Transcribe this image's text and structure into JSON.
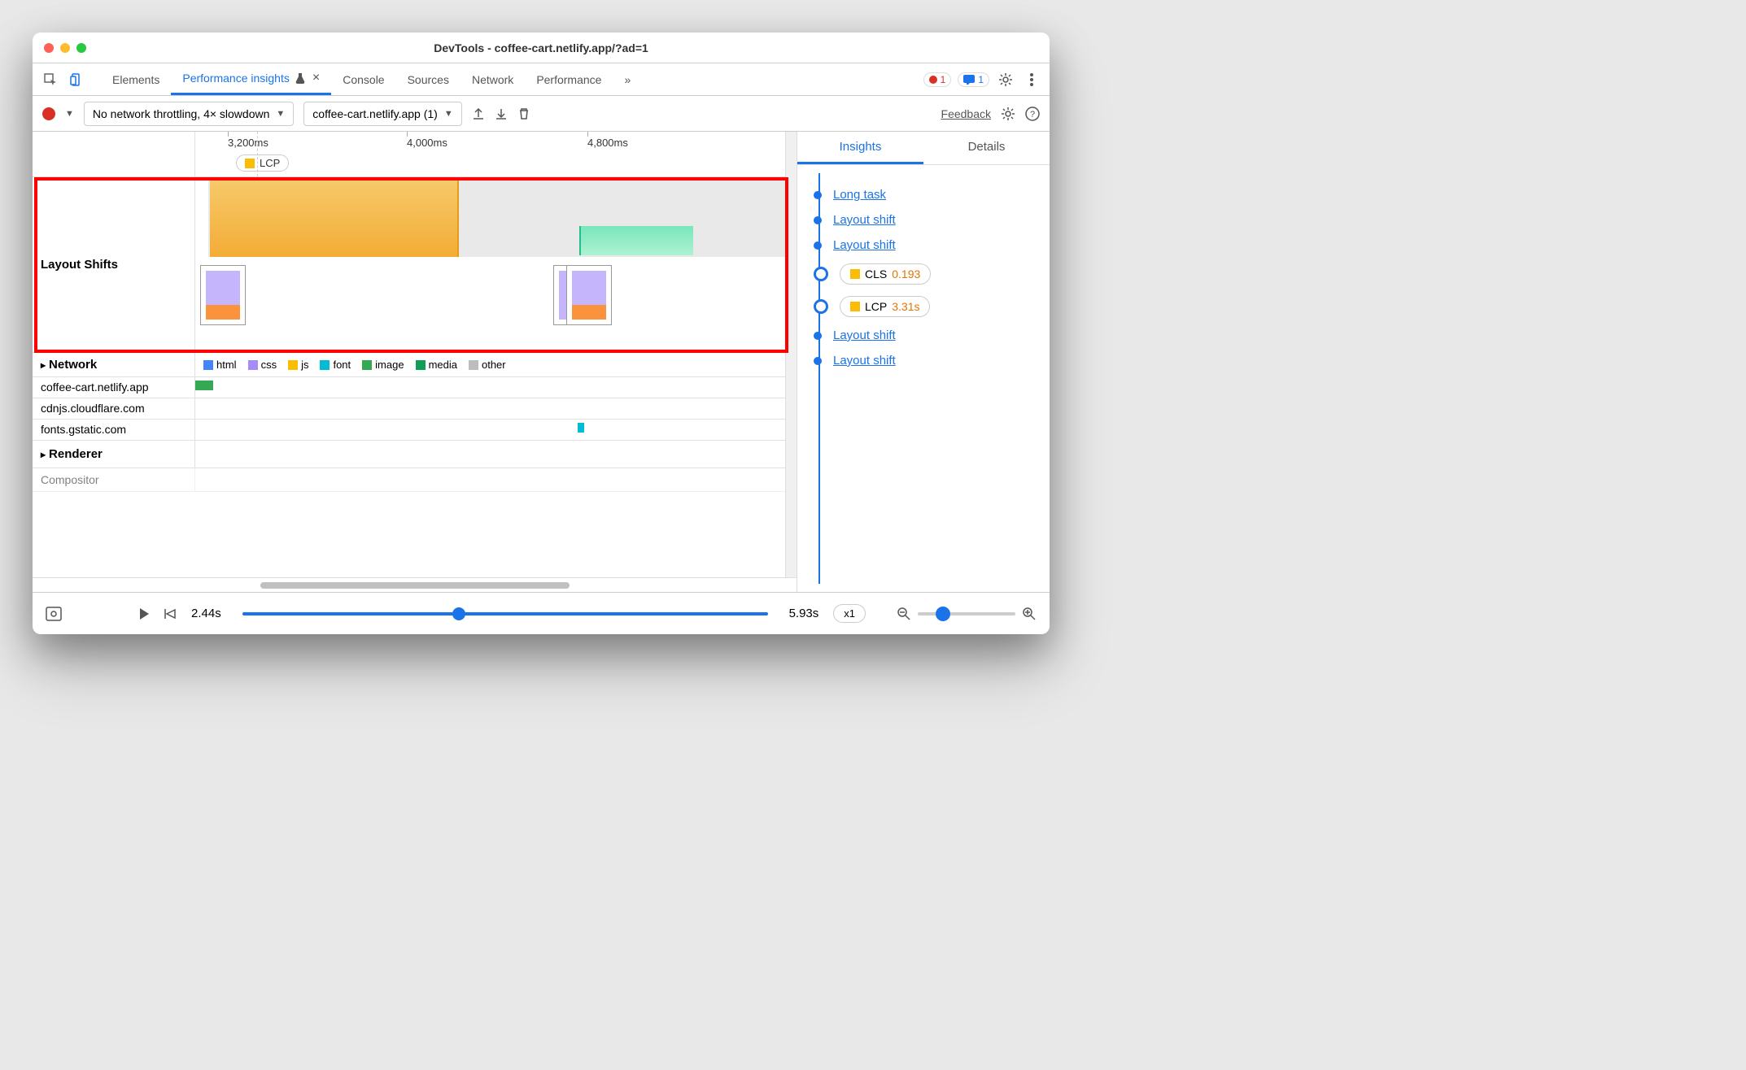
{
  "title": "DevTools - coffee-cart.netlify.app/?ad=1",
  "toolbar": {
    "tabs": [
      "Elements",
      "Performance insights",
      "Console",
      "Sources",
      "Network",
      "Performance"
    ],
    "active_index": 1,
    "more": "»",
    "error_count": "1",
    "msg_count": "1"
  },
  "subbar": {
    "throttle": "No network throttling, 4× slowdown",
    "recording": "coffee-cart.netlify.app (1)",
    "feedback": "Feedback"
  },
  "ruler": {
    "ticks": [
      {
        "pos": 40,
        "label": "3,200ms"
      },
      {
        "pos": 260,
        "label": "4,000ms"
      },
      {
        "pos": 482,
        "label": "4,800ms"
      }
    ],
    "lcp_pill": "LCP"
  },
  "tracks": {
    "layout_label": "Layout Shifts",
    "network_label": "Network",
    "renderer_label": "Renderer",
    "compositor_label": "Compositor",
    "legend": [
      "html",
      "css",
      "js",
      "font",
      "image",
      "media",
      "other"
    ],
    "hosts": [
      "coffee-cart.netlify.app",
      "cdnjs.cloudflare.com",
      "fonts.gstatic.com"
    ]
  },
  "footer": {
    "start": "2.44s",
    "end": "5.93s",
    "speed": "x1"
  },
  "right": {
    "tabs": [
      "Insights",
      "Details"
    ],
    "items": [
      {
        "type": "link",
        "label": "Long task"
      },
      {
        "type": "link",
        "label": "Layout shift"
      },
      {
        "type": "link",
        "label": "Layout shift"
      },
      {
        "type": "pill",
        "metric": "CLS",
        "value": "0.193",
        "color": "orange"
      },
      {
        "type": "pill",
        "metric": "LCP",
        "value": "3.31s",
        "color": "orange"
      },
      {
        "type": "link",
        "label": "Layout shift"
      },
      {
        "type": "link",
        "label": "Layout shift"
      }
    ]
  }
}
